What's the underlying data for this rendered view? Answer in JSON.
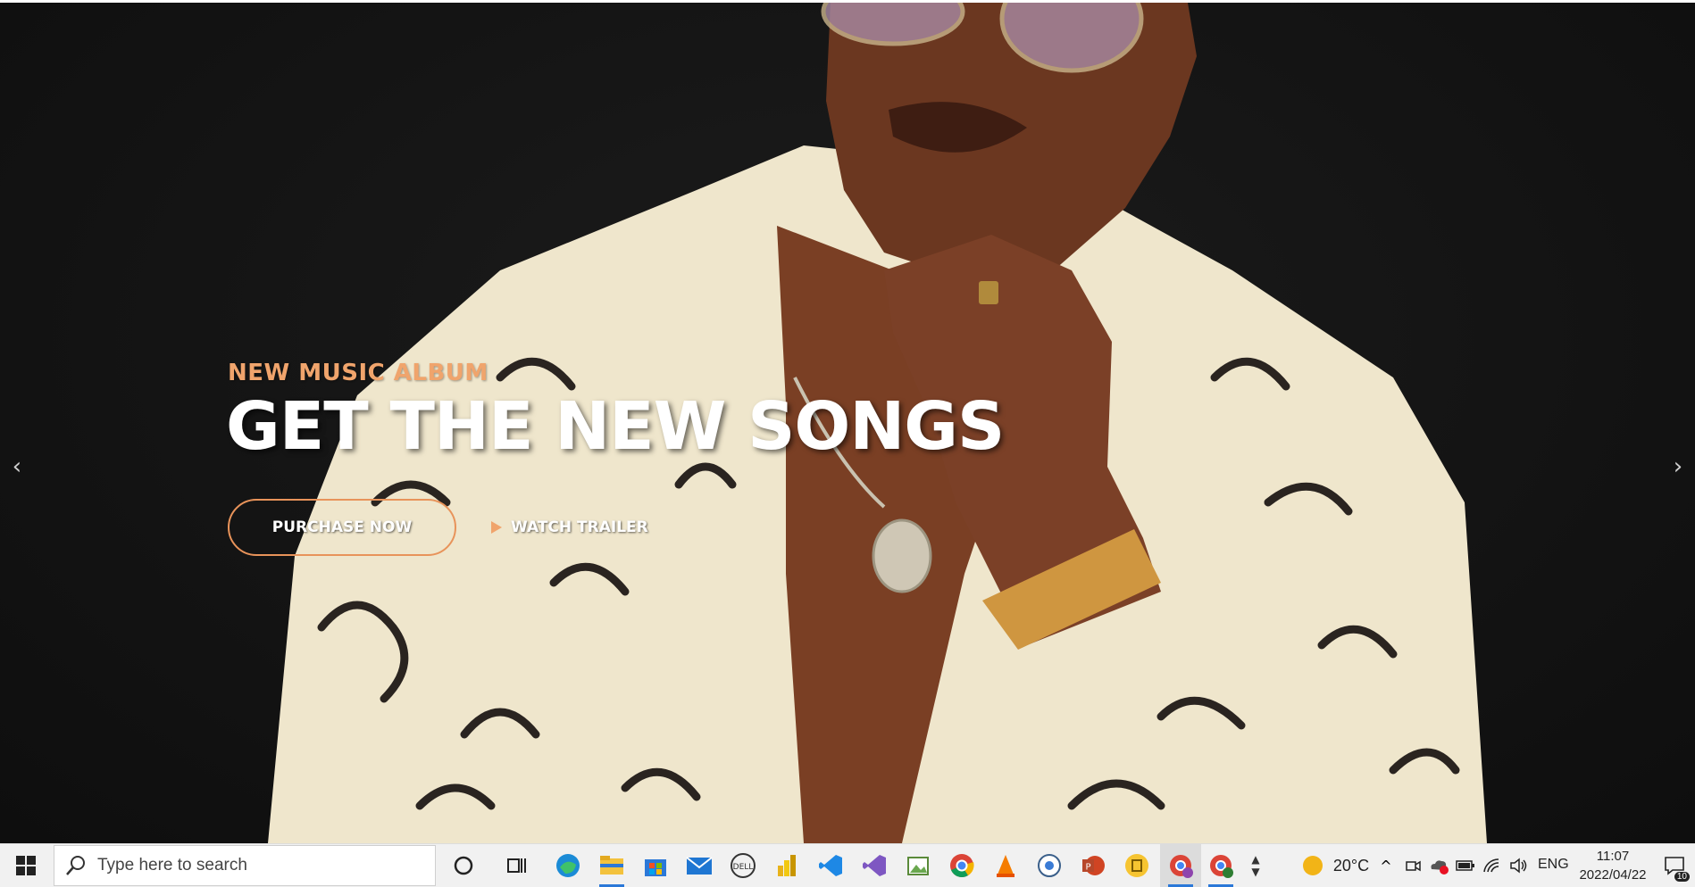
{
  "hero": {
    "subtitle": "NEW MUSIC ALBUM",
    "title": "GET THE NEW SONGS",
    "purchase_label": "PURCHASE NOW",
    "trailer_label": "WATCH TRAILER",
    "prev_arrow": "‹",
    "next_arrow": "›",
    "accent_color": "#f0a46c"
  },
  "taskbar": {
    "search_placeholder": "Type here to search",
    "apps": [
      "cortana-icon",
      "task-view-icon",
      "edge-icon",
      "file-explorer-icon",
      "microsoft-store-icon",
      "mail-icon",
      "dell-icon",
      "power-bi-icon",
      "vscode-icon",
      "visual-studio-icon",
      "image-editor-icon",
      "chrome-icon",
      "vlc-icon",
      "media-player-icon",
      "powerpoint-icon",
      "sticky-app-icon",
      "chrome-profile-s-icon",
      "chrome-profile-s-green-icon"
    ],
    "weather_temp": "20°C",
    "language": "ENG",
    "time": "11:07",
    "date": "2022/04/22",
    "notification_count": "10"
  }
}
